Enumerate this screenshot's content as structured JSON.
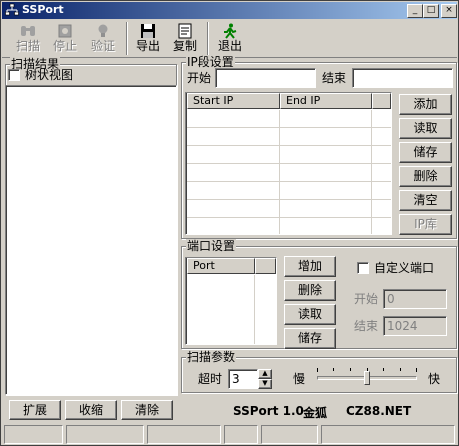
{
  "window": {
    "title": "SSPort"
  },
  "title_buttons": {
    "minimize": "_",
    "maximize": "□",
    "close": "×"
  },
  "toolbar": {
    "items": [
      {
        "label": "扫描",
        "icon": "binoculars-icon",
        "enabled": false
      },
      {
        "label": "停止",
        "icon": "stop-icon",
        "enabled": false
      },
      {
        "label": "验证",
        "icon": "lightbulb-icon",
        "enabled": false
      },
      {
        "label": "导出",
        "icon": "save-icon",
        "enabled": true
      },
      {
        "label": "复制",
        "icon": "copy-icon",
        "enabled": true
      },
      {
        "label": "退出",
        "icon": "exit-icon",
        "enabled": true
      }
    ]
  },
  "scan_results": {
    "group_label": "扫描结果",
    "tree_view_label": "树状视图",
    "tree_view_checked": false,
    "buttons": {
      "expand": "扩展",
      "collapse": "收缩",
      "clear": "清除"
    }
  },
  "ip_settings": {
    "group_label": "IP段设置",
    "start_label": "开始",
    "start_value": "",
    "end_label": "结束",
    "end_value": "",
    "columns": [
      "Start IP",
      "End IP"
    ],
    "buttons": {
      "add": "添加",
      "read": "读取",
      "save": "储存",
      "delete": "删除",
      "clear": "清空",
      "ip_lib": "IP库"
    }
  },
  "port_settings": {
    "group_label": "端口设置",
    "column": "Port",
    "buttons": {
      "add": "增加",
      "delete": "删除",
      "read": "读取",
      "save": "储存"
    },
    "custom_label": "自定义端口",
    "custom_checked": false,
    "start_label": "开始",
    "start_value": "0",
    "end_label": "结束",
    "end_value": "1024"
  },
  "scan_params": {
    "group_label": "扫描参数",
    "timeout_label": "超时",
    "timeout_value": "3",
    "slow_label": "慢",
    "fast_label": "快",
    "speed_level": 0.5
  },
  "credits": {
    "version": "SSPort 1.0",
    "author": "金狐",
    "site": "CZ88.NET"
  },
  "colors": {
    "title_start": "#0a246a",
    "title_end": "#a6caf0",
    "face": "#d4d0c8"
  }
}
